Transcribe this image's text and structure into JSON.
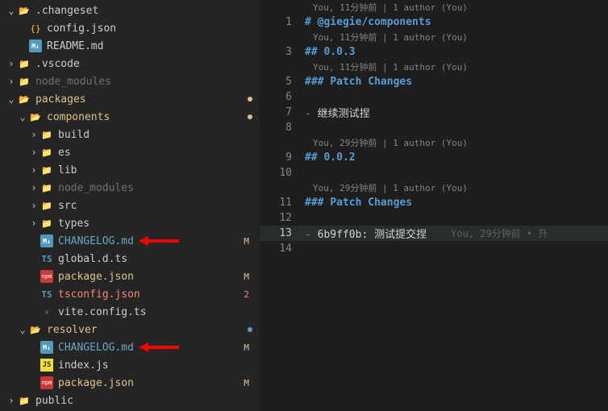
{
  "sidebar": {
    "items": [
      {
        "indent": 0,
        "chev": "open",
        "iconClass": "i-folder",
        "iconGlyph": "📂",
        "label": ".changeset",
        "color": "#cccccc"
      },
      {
        "indent": 1,
        "chev": "none",
        "iconClass": "i-json",
        "iconGlyph": "{}",
        "label": "config.json",
        "color": "#cccccc"
      },
      {
        "indent": 1,
        "chev": "none",
        "iconClass": "i-md",
        "iconGlyph": "M↓",
        "label": "README.md",
        "color": "#cccccc"
      },
      {
        "indent": 0,
        "chev": "closed",
        "iconClass": "i-folder",
        "iconGlyph": "📁",
        "label": ".vscode",
        "color": "#cccccc"
      },
      {
        "indent": 0,
        "chev": "closed",
        "iconClass": "i-folder-green",
        "iconGlyph": "📁",
        "label": "node_modules",
        "color": "#707070"
      },
      {
        "indent": 0,
        "chev": "open",
        "iconClass": "i-folder",
        "iconGlyph": "📂",
        "label": "packages",
        "color": "#e2c08d",
        "dotClass": "orange"
      },
      {
        "indent": 1,
        "chev": "open",
        "iconClass": "i-folder-red",
        "iconGlyph": "📂",
        "label": "components",
        "color": "#e2c08d",
        "dotClass": "orange"
      },
      {
        "indent": 2,
        "chev": "closed",
        "iconClass": "i-folder",
        "iconGlyph": "📁",
        "label": "build",
        "color": "#cccccc"
      },
      {
        "indent": 2,
        "chev": "closed",
        "iconClass": "i-folder",
        "iconGlyph": "📁",
        "label": "es",
        "color": "#cccccc"
      },
      {
        "indent": 2,
        "chev": "closed",
        "iconClass": "i-folder",
        "iconGlyph": "📁",
        "label": "lib",
        "color": "#cccccc"
      },
      {
        "indent": 2,
        "chev": "closed",
        "iconClass": "i-folder-green",
        "iconGlyph": "📁",
        "label": "node_modules",
        "color": "#707070"
      },
      {
        "indent": 2,
        "chev": "closed",
        "iconClass": "i-folder-green",
        "iconGlyph": "📁",
        "label": "src",
        "color": "#cccccc"
      },
      {
        "indent": 2,
        "chev": "closed",
        "iconClass": "i-folder",
        "iconGlyph": "📁",
        "label": "types",
        "color": "#cccccc"
      },
      {
        "indent": 2,
        "chev": "none",
        "iconClass": "i-md",
        "iconGlyph": "M↓",
        "label": "CHANGELOG.md",
        "color": "#6aa6c4",
        "badge": "M",
        "arrow": true
      },
      {
        "indent": 2,
        "chev": "none",
        "iconClass": "i-ts",
        "iconGlyph": "TS",
        "label": "global.d.ts",
        "color": "#cccccc"
      },
      {
        "indent": 2,
        "chev": "none",
        "iconClass": "i-npm",
        "iconGlyph": "npm",
        "label": "package.json",
        "color": "#e2c08d",
        "badge": "M"
      },
      {
        "indent": 2,
        "chev": "none",
        "iconClass": "i-ts",
        "iconGlyph": "TS",
        "label": "tsconfig.json",
        "color": "#f48771",
        "badge": "2",
        "badgeClass": "num"
      },
      {
        "indent": 2,
        "chev": "none",
        "iconClass": "i-vite",
        "iconGlyph": "⚡",
        "label": "vite.config.ts",
        "color": "#cccccc"
      },
      {
        "indent": 1,
        "chev": "open",
        "iconClass": "i-folder",
        "iconGlyph": "📂",
        "label": "resolver",
        "color": "#e2c08d",
        "dotClass": "blue"
      },
      {
        "indent": 2,
        "chev": "none",
        "iconClass": "i-md",
        "iconGlyph": "M↓",
        "label": "CHANGELOG.md",
        "color": "#6aa6c4",
        "badge": "M",
        "arrow": true
      },
      {
        "indent": 2,
        "chev": "none",
        "iconClass": "i-js",
        "iconGlyph": "JS",
        "label": "index.js",
        "color": "#cccccc"
      },
      {
        "indent": 2,
        "chev": "none",
        "iconClass": "i-npm",
        "iconGlyph": "npm",
        "label": "package.json",
        "color": "#e2c08d",
        "badge": "M"
      },
      {
        "indent": 0,
        "chev": "closed",
        "iconClass": "i-folder",
        "iconGlyph": "📁",
        "label": "public",
        "color": "#cccccc"
      }
    ]
  },
  "editor": {
    "blocks": [
      {
        "lens": "You, 11分钟前 | 1 author (You)",
        "lines": [
          {
            "n": 1,
            "spans": [
              {
                "t": "# ",
                "c": "hl-heading"
              },
              {
                "t": "@giegie/components",
                "c": "hl-heading"
              }
            ]
          }
        ]
      },
      {
        "lens": "You, 11分钟前 | 1 author (You)",
        "lines": [
          {
            "n": 3,
            "spans": [
              {
                "t": "## ",
                "c": "hl-heading"
              },
              {
                "t": "0.0.3",
                "c": "hl-heading"
              }
            ]
          }
        ]
      },
      {
        "lens": "You, 11分钟前 | 1 author (You)",
        "lines": [
          {
            "n": 5,
            "spans": [
              {
                "t": "### ",
                "c": "hl-heading"
              },
              {
                "t": "Patch Changes",
                "c": "hl-heading"
              }
            ]
          },
          {
            "n": 6,
            "spans": [
              {
                "t": "",
                "c": "hl-text"
              }
            ]
          },
          {
            "n": 7,
            "spans": [
              {
                "t": "- ",
                "c": "hl-list"
              },
              {
                "t": "继续测试捏",
                "c": "hl-text"
              }
            ]
          },
          {
            "n": 8,
            "spans": [
              {
                "t": "",
                "c": "hl-text"
              }
            ]
          }
        ]
      },
      {
        "lens": "You, 29分钟前 | 1 author (You)",
        "lines": [
          {
            "n": 9,
            "spans": [
              {
                "t": "## ",
                "c": "hl-heading"
              },
              {
                "t": "0.0.2",
                "c": "hl-heading"
              }
            ]
          },
          {
            "n": 10,
            "spans": [
              {
                "t": "",
                "c": "hl-text"
              }
            ]
          }
        ]
      },
      {
        "lens": "You, 29分钟前 | 1 author (You)",
        "lines": [
          {
            "n": 11,
            "spans": [
              {
                "t": "### ",
                "c": "hl-heading"
              },
              {
                "t": "Patch Changes",
                "c": "hl-heading"
              }
            ]
          },
          {
            "n": 12,
            "spans": [
              {
                "t": "",
                "c": "hl-text"
              }
            ]
          },
          {
            "n": 13,
            "current": true,
            "blame": "You, 29分钟前 • 升",
            "spans": [
              {
                "t": "- ",
                "c": "hl-list"
              },
              {
                "t": "6b9ff0b: ",
                "c": "hl-text"
              },
              {
                "t": "测试提交捏",
                "c": "hl-text"
              }
            ]
          },
          {
            "n": 14,
            "spans": [
              {
                "t": "",
                "c": "hl-text"
              }
            ]
          }
        ]
      }
    ]
  }
}
